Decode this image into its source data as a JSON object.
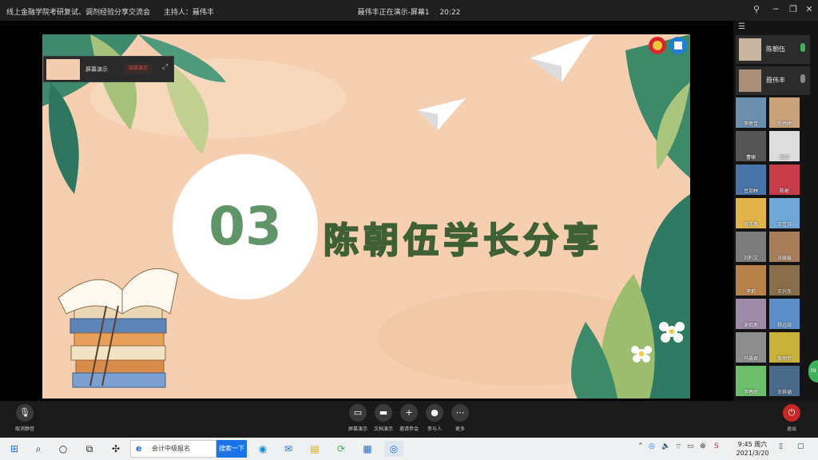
{
  "titlebar": {
    "meeting_title": "线上金融学院考研复试、调剂经验分享交流会",
    "host_label": "主持人：聂伟丰",
    "presenting": "聂伟丰正在演示-屏幕1",
    "time": "20:22"
  },
  "mini_window": {
    "label": "屏幕演示",
    "stop_label": "结束演示"
  },
  "slide": {
    "number": "03",
    "title": "陈朝伍学长分享"
  },
  "speakers": [
    {
      "name": "陈朝伍",
      "mic_color": "#3db25a"
    },
    {
      "name": "聂伟丰",
      "mic_color": "#888888"
    }
  ],
  "participants": [
    {
      "name": "李思佳"
    },
    {
      "name": "郎婷婷"
    },
    {
      "name": "曹啸"
    },
    {
      "name": "田浩"
    },
    {
      "name": "豆加林"
    },
    {
      "name": "陈彬"
    },
    {
      "name": "蒋伟燕"
    },
    {
      "name": "王佳钰"
    },
    {
      "name": "刘利文"
    },
    {
      "name": "张媛媛"
    },
    {
      "name": "李莉"
    },
    {
      "name": "王兴东"
    },
    {
      "name": "谢佰男"
    },
    {
      "name": "杨远琦"
    },
    {
      "name": "马晨君"
    },
    {
      "name": "詹雨梦"
    },
    {
      "name": "李春娇"
    },
    {
      "name": "王梓涵"
    }
  ],
  "side_badge": "39",
  "toolbar": {
    "mute_label": "取消静音",
    "buttons": [
      {
        "label": "屏幕演示",
        "icon": "screen-icon"
      },
      {
        "label": "文档演示",
        "icon": "folder-icon"
      },
      {
        "label": "邀请参会",
        "icon": "add-user-icon"
      },
      {
        "label": "参与人",
        "icon": "people-icon"
      },
      {
        "label": "更多",
        "icon": "more-icon"
      }
    ],
    "leave_label": "退出"
  },
  "taskbar": {
    "search_text": "会计中级报名",
    "search_button": "搜索一下",
    "clock_time": "9:45 周六",
    "clock_date": "2021/3/20"
  }
}
